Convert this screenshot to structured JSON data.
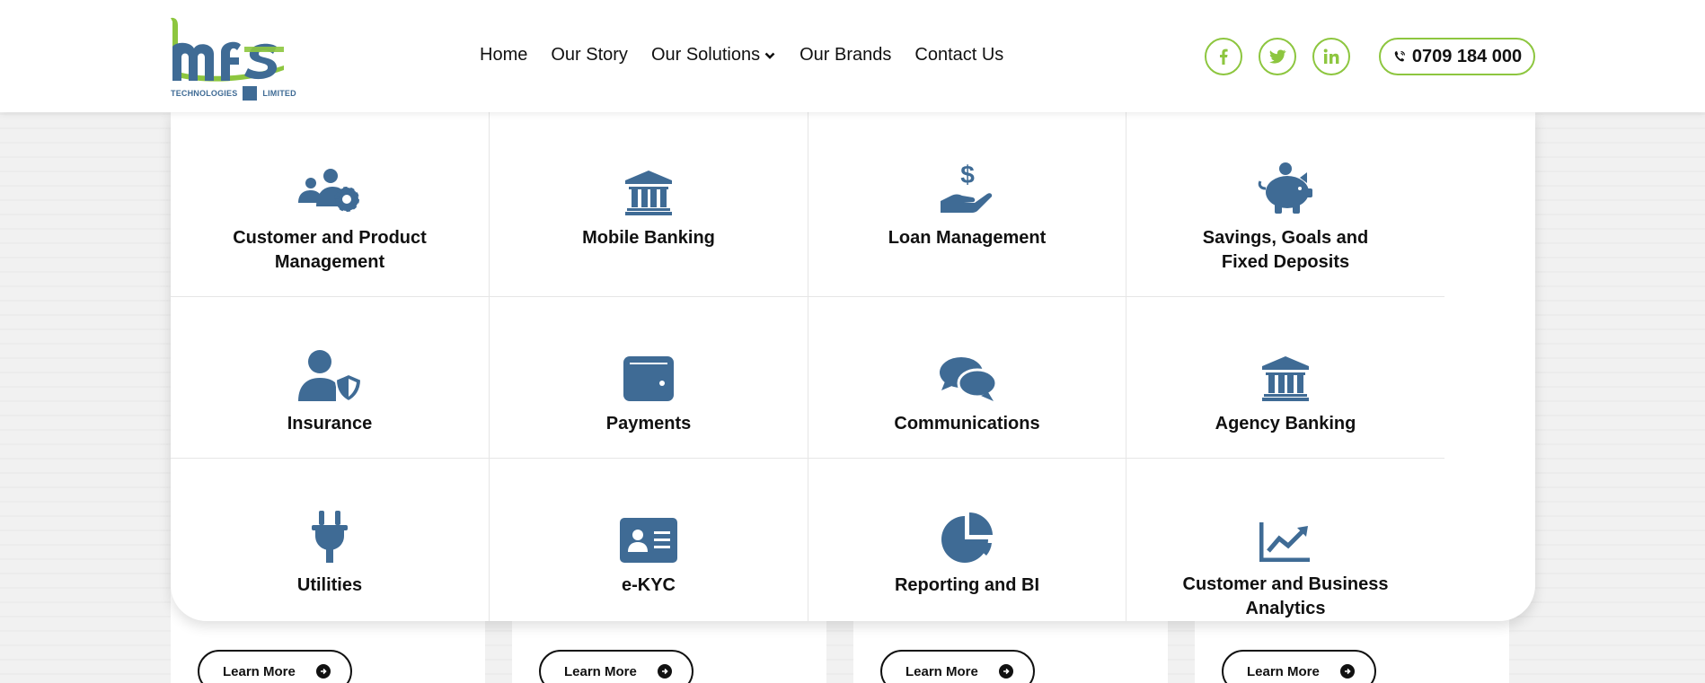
{
  "header": {
    "logo_letters": "mfs",
    "logo_caption_left": "TECHNOLOGIES",
    "logo_caption_right": "LIMITED",
    "nav": [
      "Home",
      "Our Story",
      "Our Solutions",
      "Our Brands",
      "Contact Us"
    ],
    "socials": [
      "facebook-icon",
      "twitter-icon",
      "linkedin-icon"
    ],
    "phone": "0709 184 000"
  },
  "colors": {
    "accent_green": "#8dc63f",
    "icon_blue": "#3f6b95"
  },
  "solutions": [
    {
      "label": "Customer and Product Management",
      "icon": "users-gear-icon"
    },
    {
      "label": "Mobile Banking",
      "icon": "bank-icon"
    },
    {
      "label": "Loan Management",
      "icon": "hand-dollar-icon"
    },
    {
      "label": "Savings, Goals and Fixed Deposits",
      "icon": "piggy-bank-icon"
    },
    {
      "label": "Insurance",
      "icon": "user-shield-icon"
    },
    {
      "label": "Payments",
      "icon": "wallet-icon"
    },
    {
      "label": "Communications",
      "icon": "comments-icon"
    },
    {
      "label": "Agency Banking",
      "icon": "bank-icon"
    },
    {
      "label": "Utilities",
      "icon": "plug-icon"
    },
    {
      "label": "e-KYC",
      "icon": "id-card-icon"
    },
    {
      "label": "Reporting and BI",
      "icon": "pie-chart-icon"
    },
    {
      "label": "Customer and Business Analytics",
      "icon": "chart-line-icon"
    }
  ],
  "cards": {
    "learn_more": "Learn More"
  }
}
